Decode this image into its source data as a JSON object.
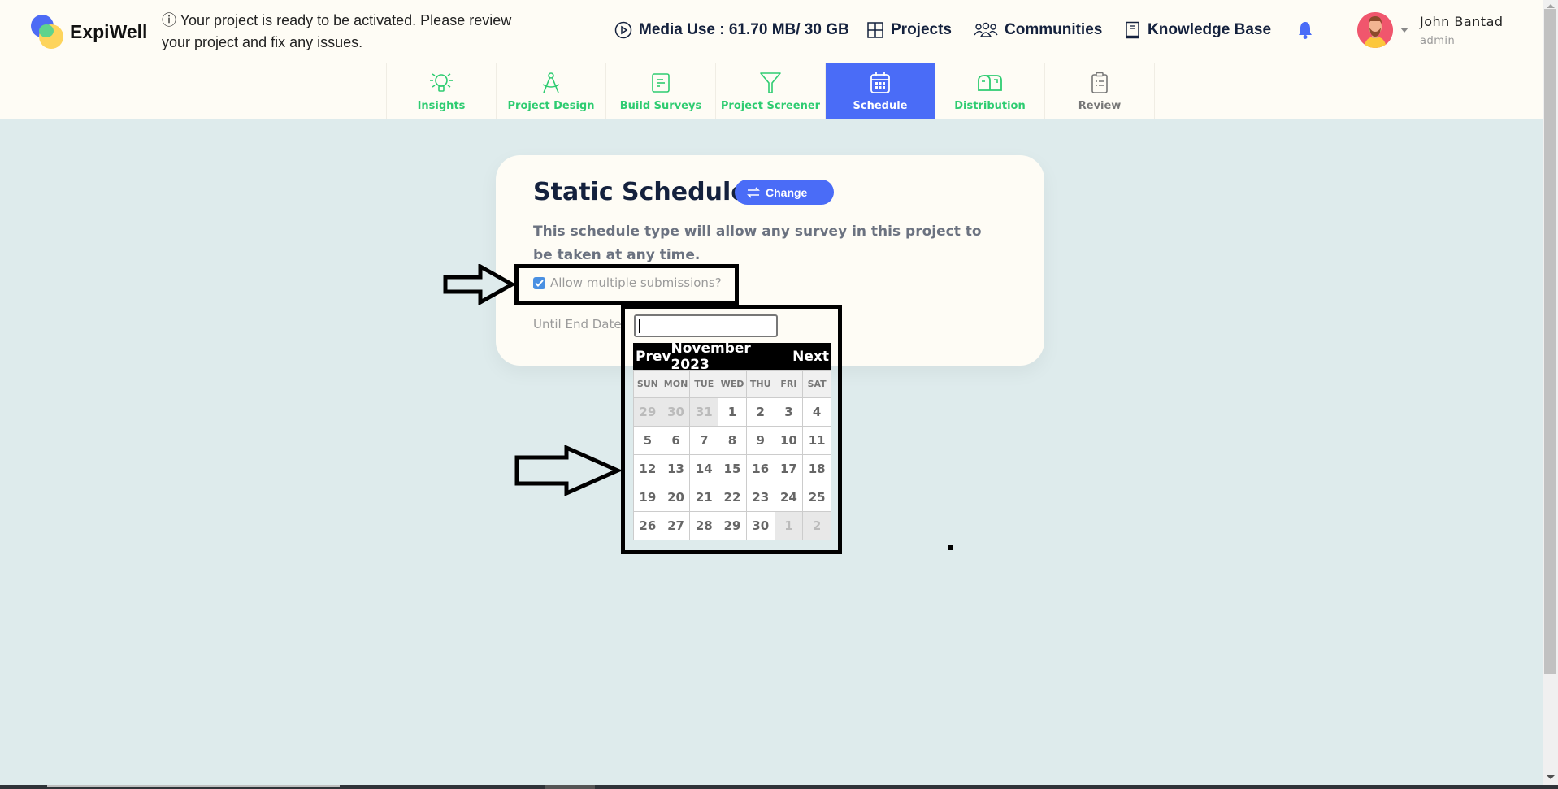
{
  "header": {
    "logo_text": "ExpiWell",
    "notice": "ⓘ Your project is ready to be activated. Please review your project and fix any issues.",
    "media_use": "Media Use : 61.70 MB/ 30 GB",
    "nav": [
      {
        "label": "Projects",
        "icon": "grid-icon"
      },
      {
        "label": "Communities",
        "icon": "users-icon"
      },
      {
        "label": "Knowledge Base",
        "icon": "book-icon"
      }
    ],
    "user": {
      "name": "John Bantad",
      "role": "admin"
    },
    "accent_color": "#4a6cf7"
  },
  "tabs": [
    {
      "label": "Insights",
      "icon": "lightbulb-icon",
      "state": "done"
    },
    {
      "label": "Project Design",
      "icon": "compass-icon",
      "state": "done"
    },
    {
      "label": "Build Surveys",
      "icon": "document-icon",
      "state": "done"
    },
    {
      "label": "Project Screener",
      "icon": "filter-icon",
      "state": "done"
    },
    {
      "label": "Schedule",
      "icon": "calendar-icon",
      "state": "active"
    },
    {
      "label": "Distribution",
      "icon": "mailbox-icon",
      "state": "done"
    },
    {
      "label": "Review",
      "icon": "clipboard-icon",
      "state": "pending"
    }
  ],
  "card": {
    "title": "Static Schedule",
    "change_label": "Change",
    "description": "This schedule type will allow any survey in this project to be taken at any time.",
    "allow_multiple_label": "Allow multiple submissions?",
    "allow_multiple_checked": true,
    "until_end_date_label": "Until End Date",
    "end_date_value": ""
  },
  "calendar": {
    "prev_label": "Prev",
    "next_label": "Next",
    "month_label": "November 2023",
    "weekdays": [
      "SUN",
      "MON",
      "TUE",
      "WED",
      "THU",
      "FRI",
      "SAT"
    ],
    "weeks": [
      [
        {
          "d": "29",
          "o": true
        },
        {
          "d": "30",
          "o": true
        },
        {
          "d": "31",
          "o": true
        },
        {
          "d": "1"
        },
        {
          "d": "2"
        },
        {
          "d": "3"
        },
        {
          "d": "4"
        }
      ],
      [
        {
          "d": "5"
        },
        {
          "d": "6"
        },
        {
          "d": "7"
        },
        {
          "d": "8"
        },
        {
          "d": "9"
        },
        {
          "d": "10"
        },
        {
          "d": "11"
        }
      ],
      [
        {
          "d": "12"
        },
        {
          "d": "13"
        },
        {
          "d": "14"
        },
        {
          "d": "15"
        },
        {
          "d": "16"
        },
        {
          "d": "17"
        },
        {
          "d": "18"
        }
      ],
      [
        {
          "d": "19"
        },
        {
          "d": "20"
        },
        {
          "d": "21"
        },
        {
          "d": "22"
        },
        {
          "d": "23"
        },
        {
          "d": "24"
        },
        {
          "d": "25"
        }
      ],
      [
        {
          "d": "26"
        },
        {
          "d": "27"
        },
        {
          "d": "28"
        },
        {
          "d": "29"
        },
        {
          "d": "30"
        },
        {
          "d": "1",
          "o": true
        },
        {
          "d": "2",
          "o": true
        }
      ]
    ]
  }
}
